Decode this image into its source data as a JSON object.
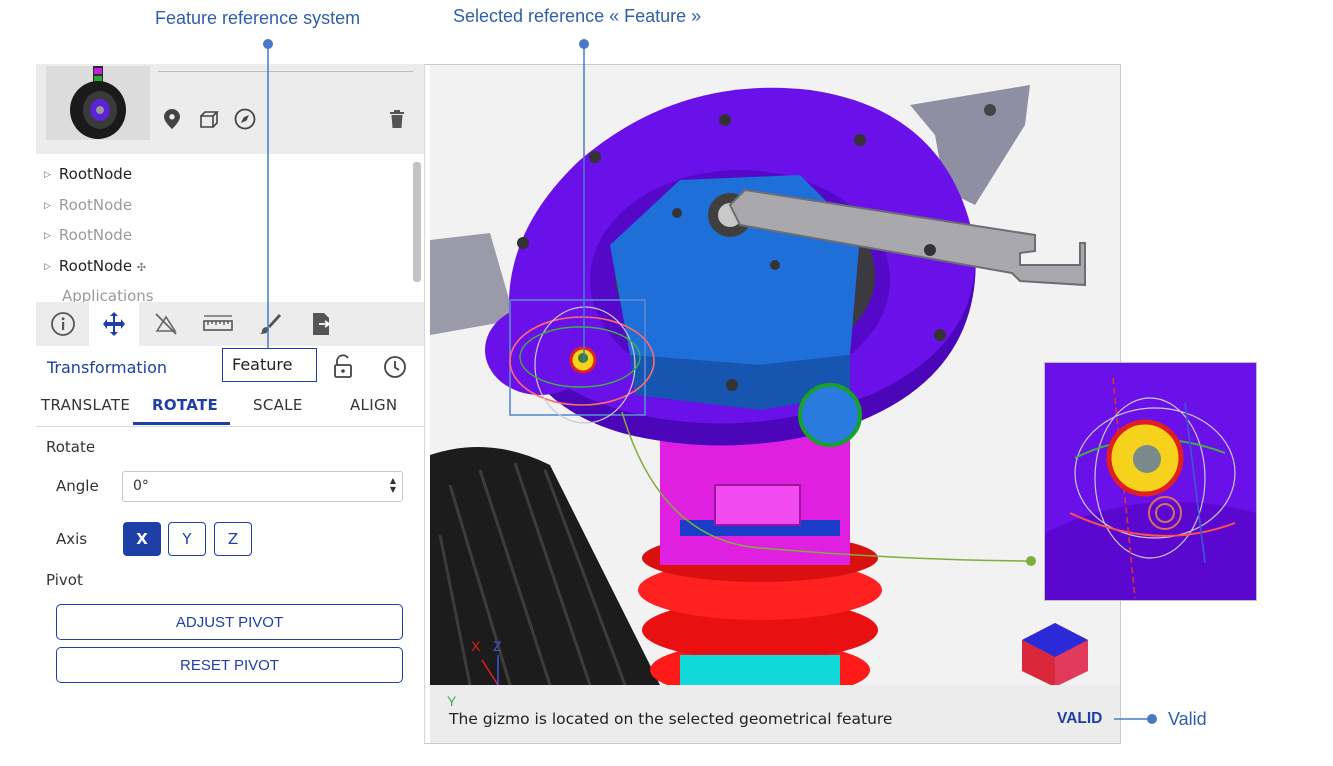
{
  "annotations": {
    "feature_reference_system": "Feature reference system",
    "selected_reference": "Selected reference « Feature »",
    "valid": "Valid"
  },
  "tree": {
    "items": [
      {
        "label": "RootNode",
        "dim": false
      },
      {
        "label": "RootNode",
        "dim": true
      },
      {
        "label": "RootNode",
        "dim": true
      },
      {
        "label": "RootNode",
        "dim": false
      },
      {
        "label": "Applications",
        "dim": true
      }
    ],
    "move_glyph": "✣"
  },
  "panel": {
    "transformation_label": "Transformation",
    "reference_value": "Feature",
    "subtabs": [
      "TRANSLATE",
      "ROTATE",
      "SCALE",
      "ALIGN"
    ],
    "active_subtab": "ROTATE",
    "rotate_section": "Rotate",
    "angle_label": "Angle",
    "angle_value": "0°",
    "axis_label": "Axis",
    "axes": [
      "X",
      "Y",
      "Z"
    ],
    "selected_axis": "X",
    "pivot_section": "Pivot",
    "adjust_pivot": "ADJUST PIVOT",
    "reset_pivot": "RESET PIVOT"
  },
  "viewport": {
    "axis_x": "X",
    "axis_z": "Z",
    "axis_y": "Y"
  },
  "status": {
    "message": "The gizmo is located on the selected geometrical feature",
    "state": "VALID"
  },
  "colors": {
    "accent": "#1e3fa6",
    "annotation": "#2f5fa8",
    "annotation_dot": "#4a78c9",
    "connector_green": "#7fae3a",
    "part_purple": "#6a10e8",
    "part_blue": "#1f6fd9",
    "part_magenta": "#e21ce8",
    "spring_red": "#f01818"
  },
  "icons": [
    "location-pin-icon",
    "box-icon",
    "compass-icon",
    "trash-icon",
    "info-icon",
    "move-icon",
    "visibility-off-icon",
    "ruler-icon",
    "brush-icon",
    "export-icon",
    "lock-icon",
    "history-icon"
  ]
}
